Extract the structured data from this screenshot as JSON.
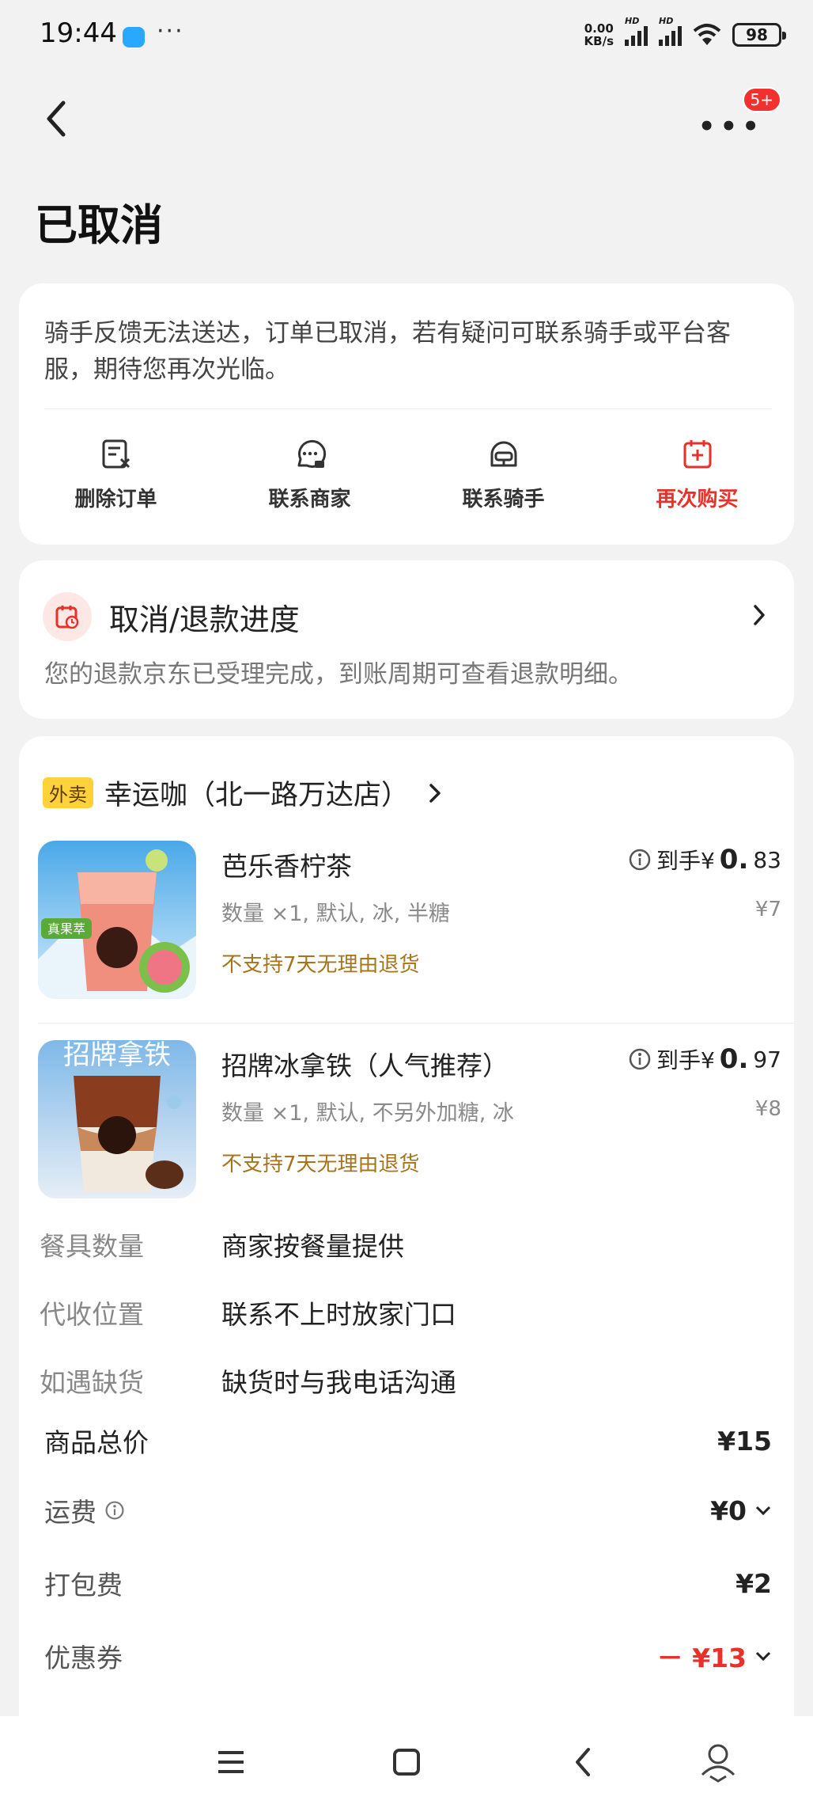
{
  "status_bar": {
    "time": "19:44",
    "dots": "···",
    "net_speed_top": "0.00",
    "net_speed_bottom": "KB/s",
    "hd1": "HD",
    "hd2": "HD",
    "battery": "98"
  },
  "header": {
    "badge": "5+",
    "title": "已取消"
  },
  "status_card": {
    "message": "骑手反馈无法送达，订单已取消，若有疑问可联系骑手或平台客服，期待您再次光临。",
    "actions": [
      {
        "label": "删除订单",
        "icon": "delete-order-icon"
      },
      {
        "label": "联系商家",
        "icon": "merchant-chat-icon"
      },
      {
        "label": "联系骑手",
        "icon": "rider-helmet-icon"
      },
      {
        "label": "再次购买",
        "icon": "calendar-plus-icon"
      }
    ],
    "accent_color": "#e8312b"
  },
  "refund_card": {
    "title": "取消/退款进度",
    "description": "您的退款京东已受理完成，到账周期可查看退款明细。"
  },
  "order": {
    "shop_tag": "外卖",
    "shop_name": "幸运咖（北一路万达店）",
    "items": [
      {
        "name": "芭乐香柠茶",
        "spec": "数量 ×1, 默认, 冰, 半糖",
        "notice": "不支持7天无理由退货",
        "price_prefix": "到手¥",
        "price_main": "0.",
        "price_minor": "83",
        "original": "¥7",
        "thumb_label": "真果萃"
      },
      {
        "name": "招牌冰拿铁（人气推荐）",
        "spec": "数量 ×1, 默认, 不另外加糖, 冰",
        "notice": "不支持7天无理由退货",
        "price_prefix": "到手¥",
        "price_main": "0.",
        "price_minor": "97",
        "original": "¥8",
        "thumb_label": "招牌拿铁"
      }
    ],
    "details": [
      {
        "key": "餐具数量",
        "value": "商家按餐量提供"
      },
      {
        "key": "代收位置",
        "value": "联系不上时放家门口"
      },
      {
        "key": "如遇缺货",
        "value": "缺货时与我电话沟通"
      }
    ],
    "summary": {
      "goods_total_label": "商品总价",
      "goods_total": "¥15",
      "shipping_label": "运费",
      "shipping": "¥0",
      "packing_label": "打包费",
      "packing": "¥2",
      "coupon_label": "优惠券",
      "coupon": "－ ¥13"
    }
  }
}
